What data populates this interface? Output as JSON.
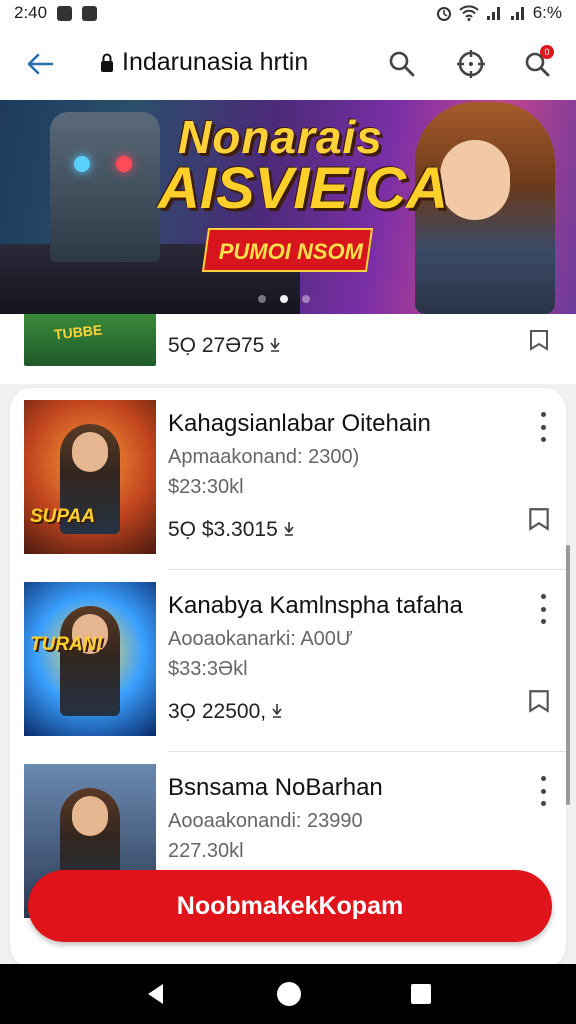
{
  "status_bar": {
    "time": "2:40",
    "battery": "6:%"
  },
  "header": {
    "title": "Indarunasia hrtin",
    "icons": [
      "back-arrow-icon",
      "lock-icon",
      "search-icon",
      "target-icon",
      "notification-icon"
    ],
    "badge": "0"
  },
  "banner": {
    "line1": "Nonarais",
    "line2": "AISVIEICA",
    "ribbon": "PUMOI NSOM",
    "page_dots": 3,
    "active_dot": 1
  },
  "partial_item": {
    "thumb_text": "TUBBE",
    "stat": "5Ọ 27Ә75"
  },
  "items": [
    {
      "name": "Kahagsianlabar Oitehain",
      "sub": "Apmaakonand: 2300)",
      "price": "$23:30kl",
      "stat": "5Ọ $3.3015",
      "thumb_text": "SUPAA"
    },
    {
      "name": "Kanabya Kamlnspha tafaha",
      "sub": "Aooaokanarki: A00Ư",
      "price": "$33:3Әkl",
      "stat": "3Ọ 22500,",
      "thumb_text": "TURAN!"
    },
    {
      "name": "Bsnsama NoBarhan",
      "sub": "Aooaakonandi: 23990",
      "price": "227.30kl",
      "stat": "",
      "thumb_text": ""
    }
  ],
  "cta": {
    "label": "NoobmakekKopam"
  },
  "colors": {
    "accent": "#e0131a",
    "back_arrow": "#2b6cb0"
  }
}
